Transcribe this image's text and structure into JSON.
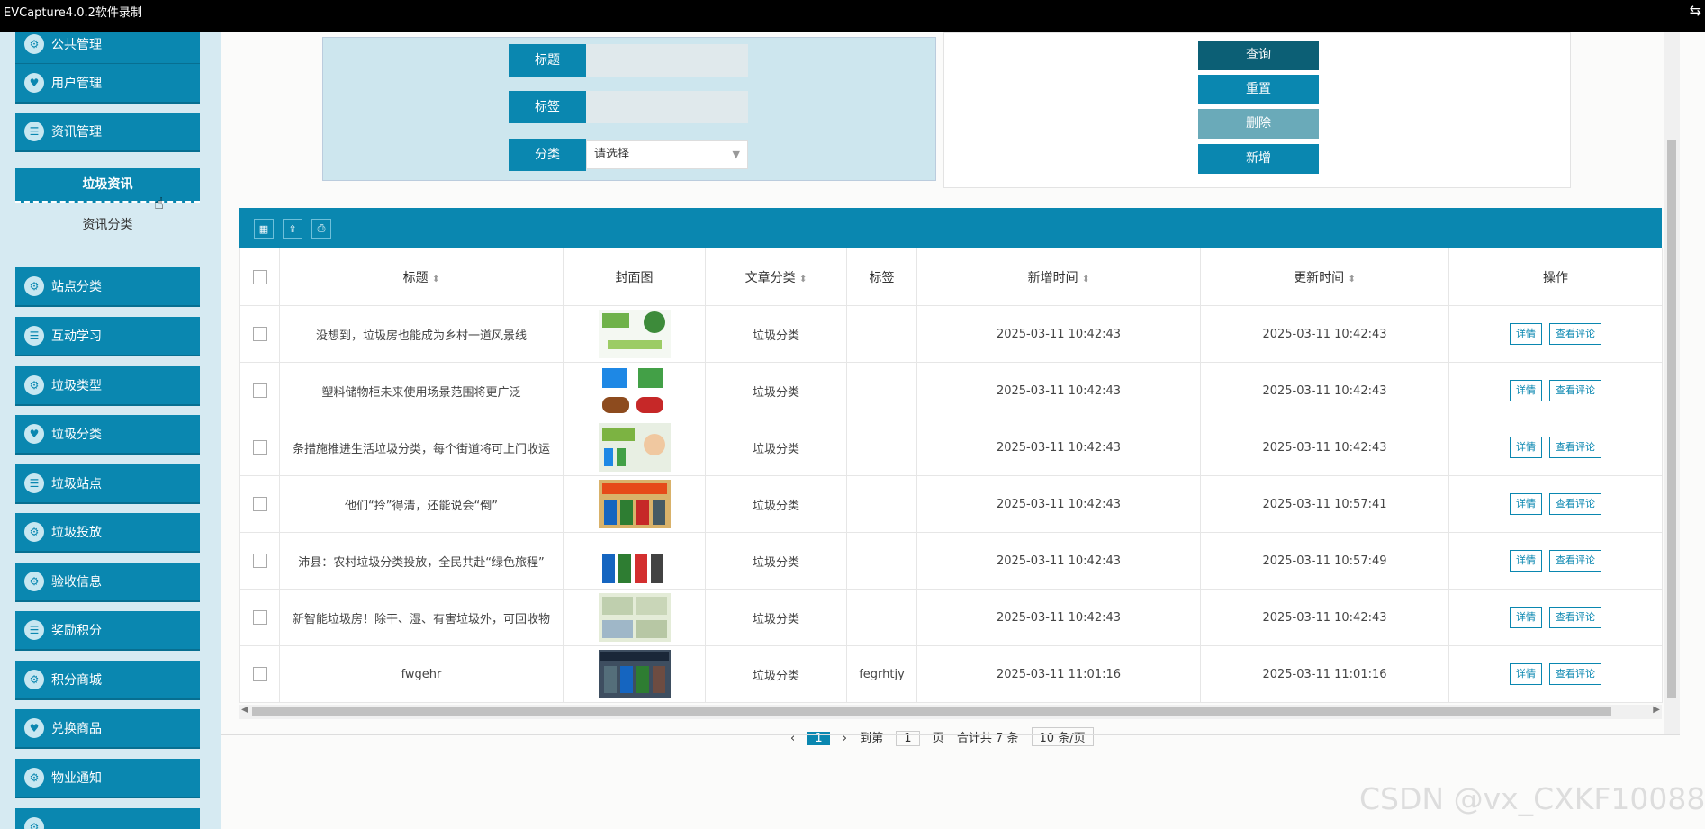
{
  "window": {
    "title": "EVCapture4.0.2软件录制"
  },
  "sidebar": {
    "items": [
      {
        "label": "公共管理",
        "icon": "gear-icon"
      },
      {
        "label": "用户管理",
        "icon": "heart-icon"
      },
      {
        "label": "资讯管理",
        "icon": "list-icon"
      },
      {
        "label": "站点分类",
        "icon": "gear-icon"
      },
      {
        "label": "互动学习",
        "icon": "list-icon"
      },
      {
        "label": "垃圾类型",
        "icon": "gear-icon"
      },
      {
        "label": "垃圾分类",
        "icon": "heart-icon"
      },
      {
        "label": "垃圾站点",
        "icon": "list-icon"
      },
      {
        "label": "垃圾投放",
        "icon": "gear-icon"
      },
      {
        "label": "验收信息",
        "icon": "gear-icon"
      },
      {
        "label": "奖励积分",
        "icon": "list-icon"
      },
      {
        "label": "积分商城",
        "icon": "gear-icon"
      },
      {
        "label": "兑换商品",
        "icon": "heart-icon"
      },
      {
        "label": "物业通知",
        "icon": "gear-icon"
      }
    ],
    "sub_active": "垃圾资讯",
    "sub_other": "资讯分类"
  },
  "search": {
    "title_label": "标题",
    "tag_label": "标签",
    "category_label": "分类",
    "category_value": "请选择"
  },
  "actions": {
    "query": "查询",
    "reset": "重置",
    "delete": "删除",
    "add": "新增"
  },
  "colors": {
    "primary": "#0a87b0",
    "query": "#0c5f75",
    "delete": "#6aaab9"
  },
  "table": {
    "headers": {
      "title": "标题",
      "cover": "封面图",
      "category": "文章分类",
      "tag": "标签",
      "created": "新增时间",
      "updated": "更新时间",
      "ops": "操作"
    },
    "detail_label": "详情",
    "comment_label": "查看评论",
    "rows": [
      {
        "title": "没想到，垃圾房也能成为乡村一道风景线",
        "category": "垃圾分类",
        "tag": "",
        "created": "2025-03-11 10:42:43",
        "updated": "2025-03-11 10:42:43"
      },
      {
        "title": "塑料储物柜未来使用场景范围将更广泛",
        "category": "垃圾分类",
        "tag": "",
        "created": "2025-03-11 10:42:43",
        "updated": "2025-03-11 10:42:43"
      },
      {
        "title": "条措施推进生活垃圾分类，每个街道将可上门收运",
        "category": "垃圾分类",
        "tag": "",
        "created": "2025-03-11 10:42:43",
        "updated": "2025-03-11 10:42:43"
      },
      {
        "title": "他们“拎”得清，还能说会“倒”",
        "category": "垃圾分类",
        "tag": "",
        "created": "2025-03-11 10:42:43",
        "updated": "2025-03-11 10:57:41"
      },
      {
        "title": "沛县：农村垃圾分类投放，全民共赴“绿色旅程”",
        "category": "垃圾分类",
        "tag": "",
        "created": "2025-03-11 10:42:43",
        "updated": "2025-03-11 10:57:49"
      },
      {
        "title": "新智能垃圾房！除干、湿、有害垃圾外，可回收物",
        "category": "垃圾分类",
        "tag": "",
        "created": "2025-03-11 10:42:43",
        "updated": "2025-03-11 10:42:43"
      },
      {
        "title": "fwgehr",
        "category": "垃圾分类",
        "tag": "fegrhtjy",
        "created": "2025-03-11 11:01:16",
        "updated": "2025-03-11 11:01:16"
      }
    ]
  },
  "pager": {
    "current": "1",
    "goto": "到第",
    "page_input": "1",
    "page_unit": "页",
    "total": "合计共 7 条",
    "per_page": "10 条/页"
  },
  "watermark": "CSDN @vx_CXKF10088"
}
